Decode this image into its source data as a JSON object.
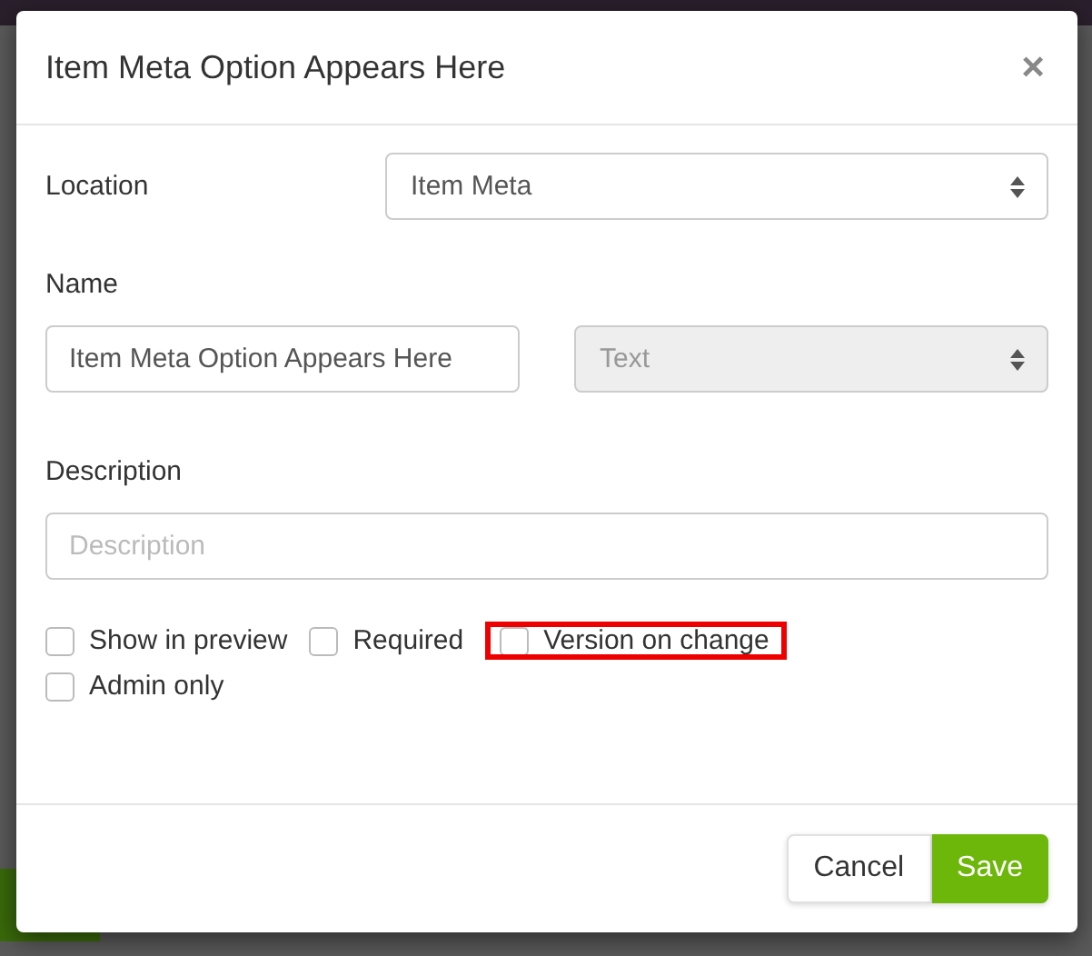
{
  "dialog": {
    "title": "Item Meta Option Appears Here",
    "close": "×",
    "location": {
      "label": "Location",
      "value": "Item Meta"
    },
    "name": {
      "label": "Name",
      "value": "Item Meta Option Appears Here",
      "type_value": "Text",
      "type_disabled": true
    },
    "description": {
      "label": "Description",
      "placeholder": "Description"
    },
    "options": [
      {
        "label": "Show in preview",
        "checked": false,
        "highlighted": false
      },
      {
        "label": "Required",
        "checked": false,
        "highlighted": false
      },
      {
        "label": "Version on change",
        "checked": false,
        "highlighted": true
      },
      {
        "label": "Admin only",
        "checked": false,
        "highlighted": false
      }
    ],
    "buttons": [
      {
        "label": "Cancel",
        "kind": "default"
      },
      {
        "label": "Save",
        "kind": "primary"
      }
    ]
  }
}
